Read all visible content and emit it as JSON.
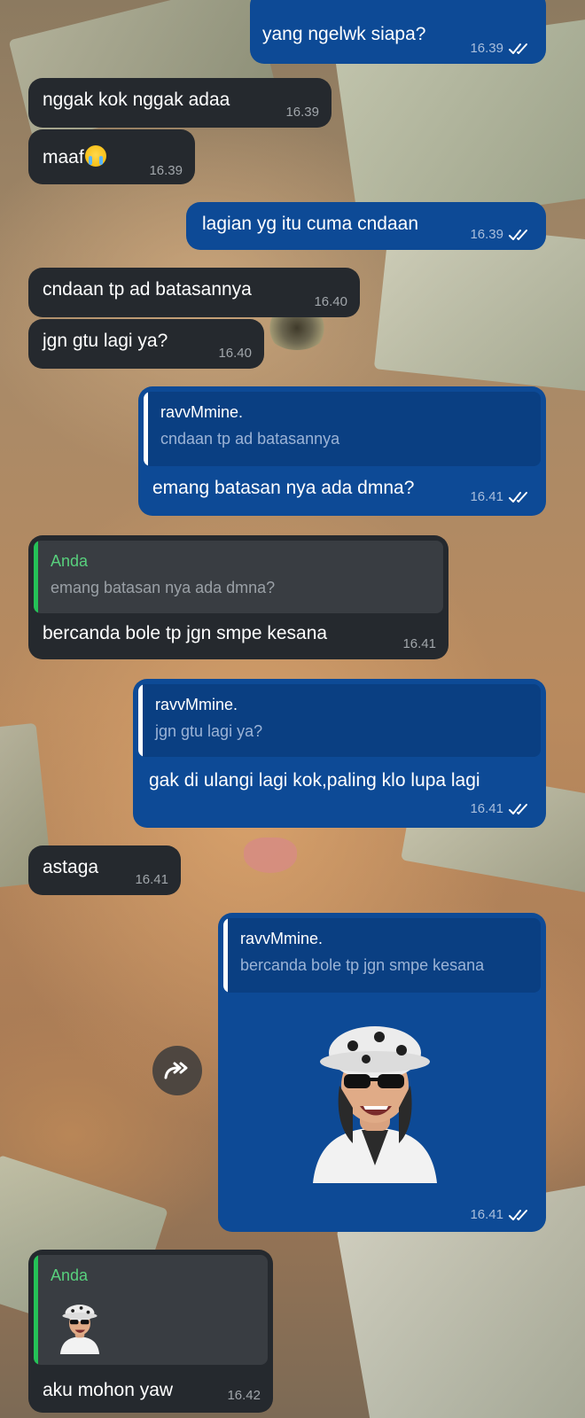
{
  "chat": {
    "messages": [
      {
        "direction": "outgoing",
        "text": "yang ngelwk siapa?",
        "time": "16.39",
        "status": "read"
      },
      {
        "direction": "incoming",
        "text": "nggak kok nggak adaa",
        "time": "16.39"
      },
      {
        "direction": "incoming",
        "text": "maaf",
        "emoji": "loudly-crying-face",
        "time": "16.39"
      },
      {
        "direction": "outgoing",
        "text": "lagian yg itu cuma cndaan",
        "time": "16.39",
        "status": "read"
      },
      {
        "direction": "incoming",
        "text": "cndaan tp ad batasannya",
        "time": "16.40"
      },
      {
        "direction": "incoming",
        "text": "jgn gtu lagi ya?",
        "time": "16.40"
      },
      {
        "direction": "outgoing",
        "reply": {
          "name": "ravvMmine.",
          "text": "cndaan tp ad batasannya"
        },
        "text": "emang batasan nya ada dmna?",
        "time": "16.41",
        "status": "read"
      },
      {
        "direction": "incoming",
        "reply": {
          "name": "Anda",
          "text": "emang batasan nya ada dmna?"
        },
        "text": "bercanda bole tp jgn smpe kesana",
        "time": "16.41"
      },
      {
        "direction": "outgoing",
        "reply": {
          "name": "ravvMmine.",
          "text": "jgn gtu lagi ya?"
        },
        "text": "gak di ulangi lagi kok,paling klo lupa lagi",
        "time": "16.41",
        "status": "read"
      },
      {
        "direction": "incoming",
        "text": "astaga",
        "time": "16.41"
      },
      {
        "direction": "outgoing",
        "reply": {
          "name": "ravvMmine.",
          "text": "bercanda bole tp jgn smpe kesana"
        },
        "sticker": "3d-avatar-bucket-hat-sunglasses",
        "time": "16.41",
        "status": "read"
      },
      {
        "direction": "incoming",
        "reply": {
          "name": "Anda",
          "sticker": "3d-avatar-bucket-hat-sunglasses"
        },
        "text": "aku mohon yaw",
        "time": "16.42"
      }
    ]
  },
  "colors": {
    "incoming_bubble": "#25292e",
    "outgoing_bubble": "#0d4a96",
    "reply_accent_incoming": "#25c257",
    "read_ticks": "#ffffff"
  },
  "icons": {
    "read_receipt": "double-check-icon",
    "forward": "forward-icon"
  }
}
